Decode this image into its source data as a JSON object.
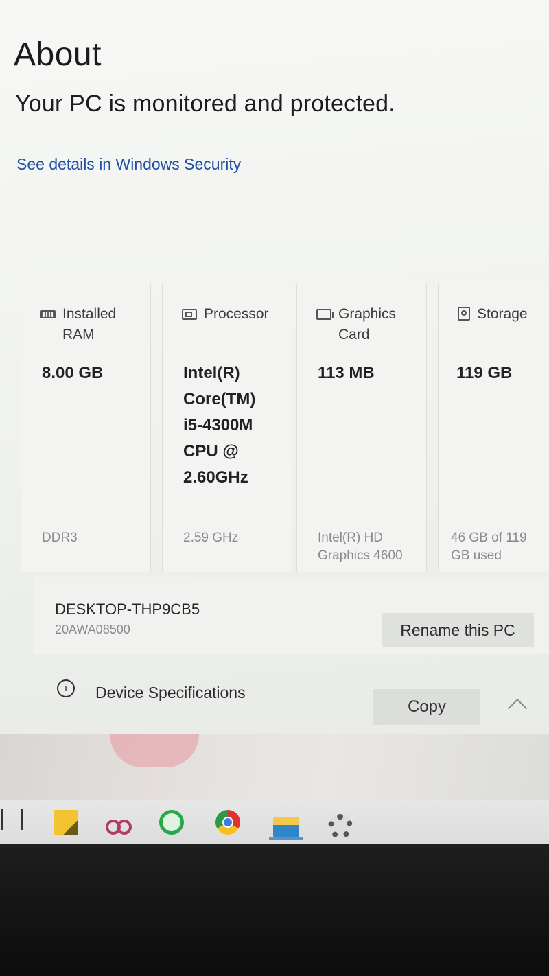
{
  "page": {
    "title": "About",
    "protection_status": "Your PC is monitored and protected.",
    "security_link": "See details in Windows Security"
  },
  "specs": [
    {
      "icon": "ram-icon",
      "label": "Installed\nRAM",
      "value": "8.00 GB",
      "detail": "DDR3"
    },
    {
      "icon": "processor-icon",
      "label": "Processor",
      "value": "Intel(R) Core(TM) i5-4300M CPU @ 2.60GHz",
      "detail": "2.59 GHz"
    },
    {
      "icon": "graphics-card-icon",
      "label": "Graphics\nCard",
      "value": "113 MB",
      "detail": "Intel(R) HD Graphics 4600"
    },
    {
      "icon": "storage-icon",
      "label": "Storage",
      "value": "119 GB",
      "detail": "46 GB of 119 GB used"
    }
  ],
  "device": {
    "name": "DESKTOP-THP9CB5",
    "model": "20AWA08500",
    "rename_label": "Rename this PC"
  },
  "specifications": {
    "label": "Device Specifications",
    "copy_label": "Copy"
  },
  "taskbar": {
    "icons": [
      "task-view-icon",
      "sticky-notes-icon",
      "snipping-tool-icon",
      "whatsapp-icon",
      "chrome-icon",
      "file-explorer-icon",
      "settings-icon"
    ],
    "active": "file-explorer-icon"
  }
}
